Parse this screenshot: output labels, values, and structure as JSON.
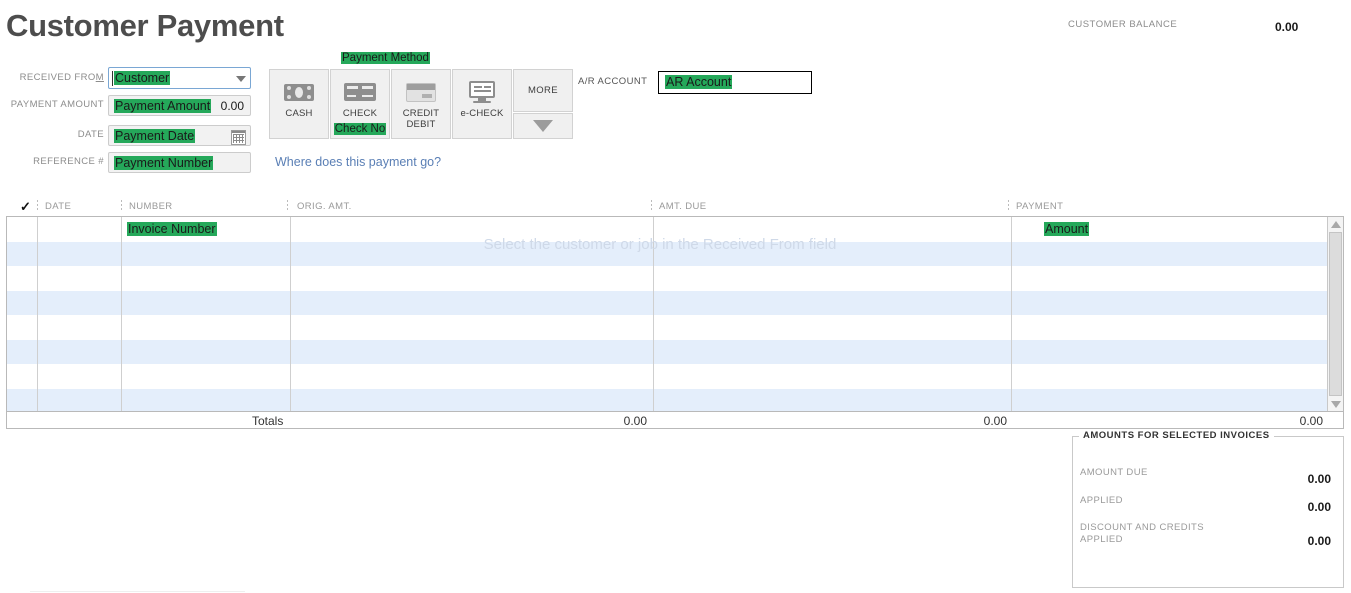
{
  "page": {
    "title": "Customer Payment"
  },
  "customer_balance": {
    "label": "CUSTOMER BALANCE",
    "value": "0.00"
  },
  "form": {
    "received_from": {
      "label": "RECEIVED FROM",
      "value": "Customer"
    },
    "payment_amount": {
      "label": "PAYMENT AMOUNT",
      "value": "Payment Amount",
      "amount": "0.00"
    },
    "date": {
      "label": "DATE",
      "value": "Payment Date",
      "icon": "calendar-icon"
    },
    "reference": {
      "label": "REFERENCE #",
      "value": "Payment Number"
    }
  },
  "payment_method": {
    "label": "Payment Method",
    "buttons": [
      {
        "label": "CASH",
        "icon": "cash-icon",
        "sub": ""
      },
      {
        "label": "CHECK",
        "icon": "check-icon",
        "sub": "Check No"
      },
      {
        "label": "CREDIT DEBIT",
        "label_line1": "CREDIT",
        "label_line2": "DEBIT",
        "icon": "credit-card-icon",
        "sub": ""
      },
      {
        "label": "e-CHECK",
        "icon": "echeck-monitor-icon",
        "sub": ""
      }
    ],
    "more_label": "MORE",
    "more_arrow_icon": "chevron-down-icon"
  },
  "ar_account": {
    "label": "A/R ACCOUNT",
    "value": "AR Account"
  },
  "where_link": "Where does this payment go?",
  "table": {
    "columns": [
      {
        "key": "check",
        "label": "✓"
      },
      {
        "key": "date",
        "label": "DATE"
      },
      {
        "key": "number",
        "label": "NUMBER"
      },
      {
        "key": "orig_amt",
        "label": "ORIG. AMT."
      },
      {
        "key": "amt_due",
        "label": "AMT. DUE"
      },
      {
        "key": "payment",
        "label": "PAYMENT"
      }
    ],
    "placeholder_message": "Select the customer or job in the Received From field",
    "first_row": {
      "number": "Invoice Number",
      "payment": "Amount"
    },
    "row_count": 8,
    "totals": {
      "label": "Totals",
      "orig_amt": "0.00",
      "amt_due": "0.00",
      "payment": "0.00"
    },
    "scrollbar": {
      "up_icon": "scroll-up-arrow-icon",
      "down_icon": "scroll-down-arrow-icon"
    }
  },
  "amounts_panel": {
    "title": "AMOUNTS FOR SELECTED INVOICES",
    "rows": [
      {
        "label": "AMOUNT DUE",
        "value": "0.00"
      },
      {
        "label": "APPLIED",
        "value": "0.00"
      },
      {
        "label": "DISCOUNT AND CREDITS APPLIED",
        "label_line1": "DISCOUNT AND CREDITS",
        "label_line2": "APPLIED",
        "value": "0.00"
      }
    ]
  },
  "colors": {
    "highlight_green": "#25a85a",
    "link_blue": "#5a7fb5",
    "row_alt_blue": "#e4eefb",
    "title_gray": "#4d4d4d"
  }
}
